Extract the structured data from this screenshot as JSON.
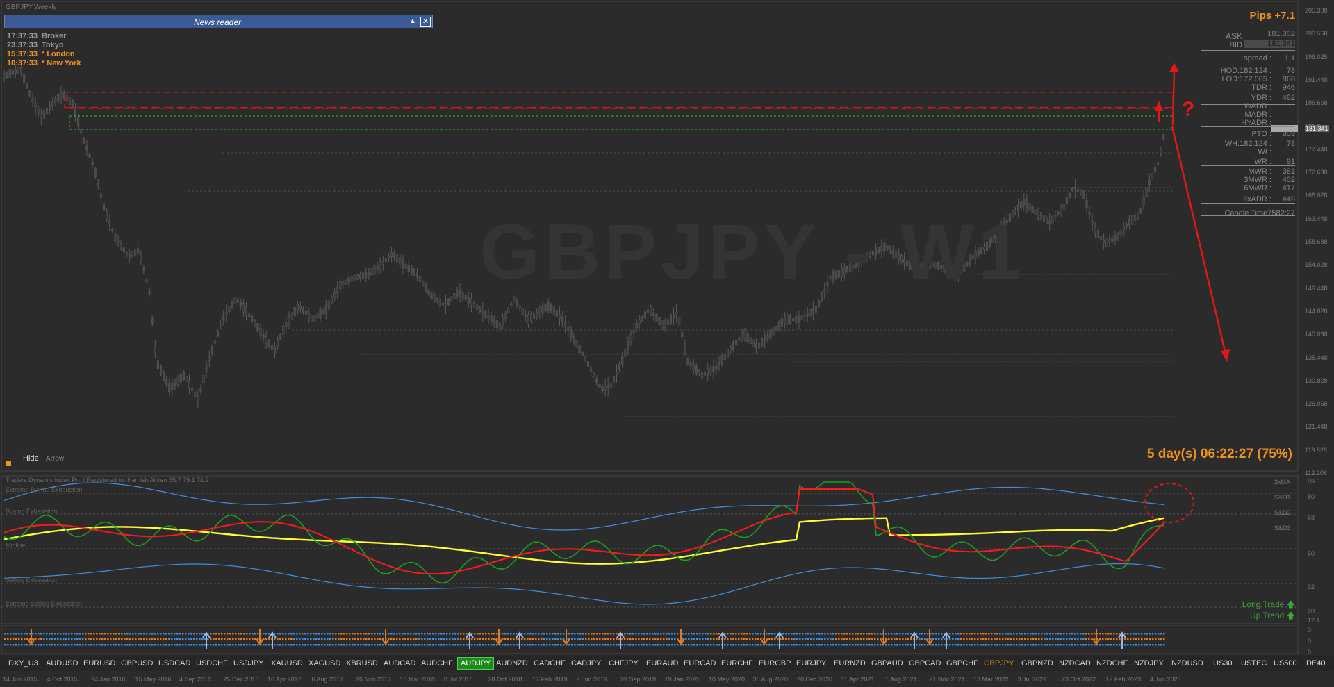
{
  "window": {
    "title": "GBPJPY,Weekly"
  },
  "news_reader": {
    "title": "News reader",
    "collapse_glyph": "▲",
    "close_glyph": "✕"
  },
  "clocks": [
    {
      "time": "17:37:33",
      "label": "Broker",
      "color": "#9a9a9a"
    },
    {
      "time": "23:37:33",
      "label": "Tokyo",
      "color": "#9a9a9a"
    },
    {
      "time": "15:37:33",
      "label": "* London",
      "color": "#f0931e"
    },
    {
      "time": "10:37:33",
      "label": "* New York",
      "color": "#f0931e"
    }
  ],
  "watermark": "GBPJPY - W1",
  "info_panel": {
    "pips": "Pips +7.1",
    "ask_label": "ASK",
    "ask": "181.352",
    "bid_label": "BID",
    "bid": "181.341",
    "rows": [
      {
        "label": "spread :",
        "value": "1.1",
        "color": "#8a8a8a"
      },
      {
        "label": "HOD:182.124 :",
        "value": "78",
        "color": "#8a8a8a"
      },
      {
        "label": "LOD:172.665 :",
        "value": "868",
        "color": "#8a8a8a"
      },
      {
        "label": "TDR :",
        "value": "946",
        "color": "#8a8a8a"
      },
      {
        "label": "YDR :",
        "value": "482",
        "color": "#8a8a8a"
      },
      {
        "label": "WADR :",
        "value": "",
        "color": "#3aa63a"
      },
      {
        "label": "MADR :",
        "value": "",
        "color": "#3aa63a"
      },
      {
        "label": "HYADR :",
        "value": "",
        "color": "#3aa63a"
      },
      {
        "label": "PTO :",
        "value": "803",
        "color": "#8a8a8a"
      },
      {
        "label": "WH:182.124 :",
        "value": "78",
        "color": "#8a8a8a"
      },
      {
        "label": "WL:",
        "value": "",
        "color": "#3aa63a"
      },
      {
        "label": "WR :",
        "value": "91",
        "color": "#8a8a8a"
      },
      {
        "label": "MWR :",
        "value": "381",
        "color": "#8a8a8a"
      },
      {
        "label": "3MWR :",
        "value": "402",
        "color": "#8a8a8a"
      },
      {
        "label": "6MWR :",
        "value": "417",
        "color": "#8a8a8a"
      },
      {
        "label": "3xADR :",
        "value": "449",
        "color": "#8a8a8a"
      }
    ],
    "candle_time": "Candle Time7582:27"
  },
  "countdown": "5 day(s) 06:22:27 (75%)",
  "controls": {
    "hide": "Hide",
    "arrow": "Arrow"
  },
  "price_axis": [
    "205.308",
    "200.568",
    "196.025",
    "191.448",
    "186.668",
    "181.2xx",
    "177.448",
    "172.688",
    "168.028",
    "163.448",
    "158.688",
    "154.028",
    "149.448",
    "144.828",
    "140.068",
    "135.448",
    "130.828",
    "126.068",
    "121.448",
    "116.828",
    "112.208"
  ],
  "price_marker": "181.341",
  "tdi": {
    "title": "Traders Dynamic Index Pro | Registered to: Hamish Aitken 55.7 79.1 71.9",
    "zones": [
      "Extreme Buying Exhaustion",
      "Buying Exhaustion",
      "Midline",
      "Selling Exhaustion",
      "Extreme Selling Exhaustion"
    ],
    "right_labels": [
      "2xMA",
      "S&D1",
      "S&D2",
      "S&D3"
    ],
    "axis": [
      "89.5",
      "80",
      "68",
      "50",
      "32",
      "20",
      "12.1"
    ],
    "long_trade": "Long Trade",
    "up_trend": "Up Trend",
    "arrow_glyph": "🡅"
  },
  "strip_axis": [
    "0",
    "0",
    "0"
  ],
  "time_axis": [
    "14 Jun 2015",
    "4 Oct 2015",
    "24 Jan 2016",
    "15 May 2016",
    "4 Sep 2016",
    "25 Dec 2016",
    "16 Apr 2017",
    "6 Aug 2017",
    "26 Nov 2017",
    "18 Mar 2018",
    "8 Jul 2018",
    "28 Oct 2018",
    "17 Feb 2019",
    "9 Jun 2019",
    "29 Sep 2019",
    "19 Jan 2020",
    "10 May 2020",
    "30 Aug 2020",
    "20 Dec 2020",
    "11 Apr 2021",
    "1 Aug 2021",
    "21 Nov 2021",
    "13 Mar 2022",
    "3 Jul 2022",
    "23 Oct 2022",
    "12 Feb 2023",
    "4 Jun 2023"
  ],
  "symbols": [
    "DXY_U3",
    "AUDUSD",
    "EURUSD",
    "GBPUSD",
    "USDCAD",
    "USDCHF",
    "USDJPY",
    "XAUUSD",
    "XAGUSD",
    "XBRUSD",
    "AUDCAD",
    "AUDCHF",
    "AUDJPY",
    "AUDNZD",
    "CADCHF",
    "CADJPY",
    "CHFJPY",
    "EURAUD",
    "EURCAD",
    "EURCHF",
    "EURGBP",
    "EURJPY",
    "EURNZD",
    "GBPAUD",
    "GBPCAD",
    "GBPCHF",
    "GBPJPY",
    "GBPNZD",
    "NZDCAD",
    "NZDCHF",
    "NZDJPY",
    "NZDUSD",
    "US30",
    "USTEC",
    "US500",
    "DE40"
  ],
  "active_symbol": "AUDJPY",
  "current_symbol": "GBPJPY",
  "annotation": {
    "question_mark": "?"
  },
  "colors": {
    "fast": "#ff1a1a",
    "rsi": "#1e9e1e",
    "slow": "#ffff33",
    "bands": "#3f8fe0",
    "accent": "#f0931e"
  }
}
